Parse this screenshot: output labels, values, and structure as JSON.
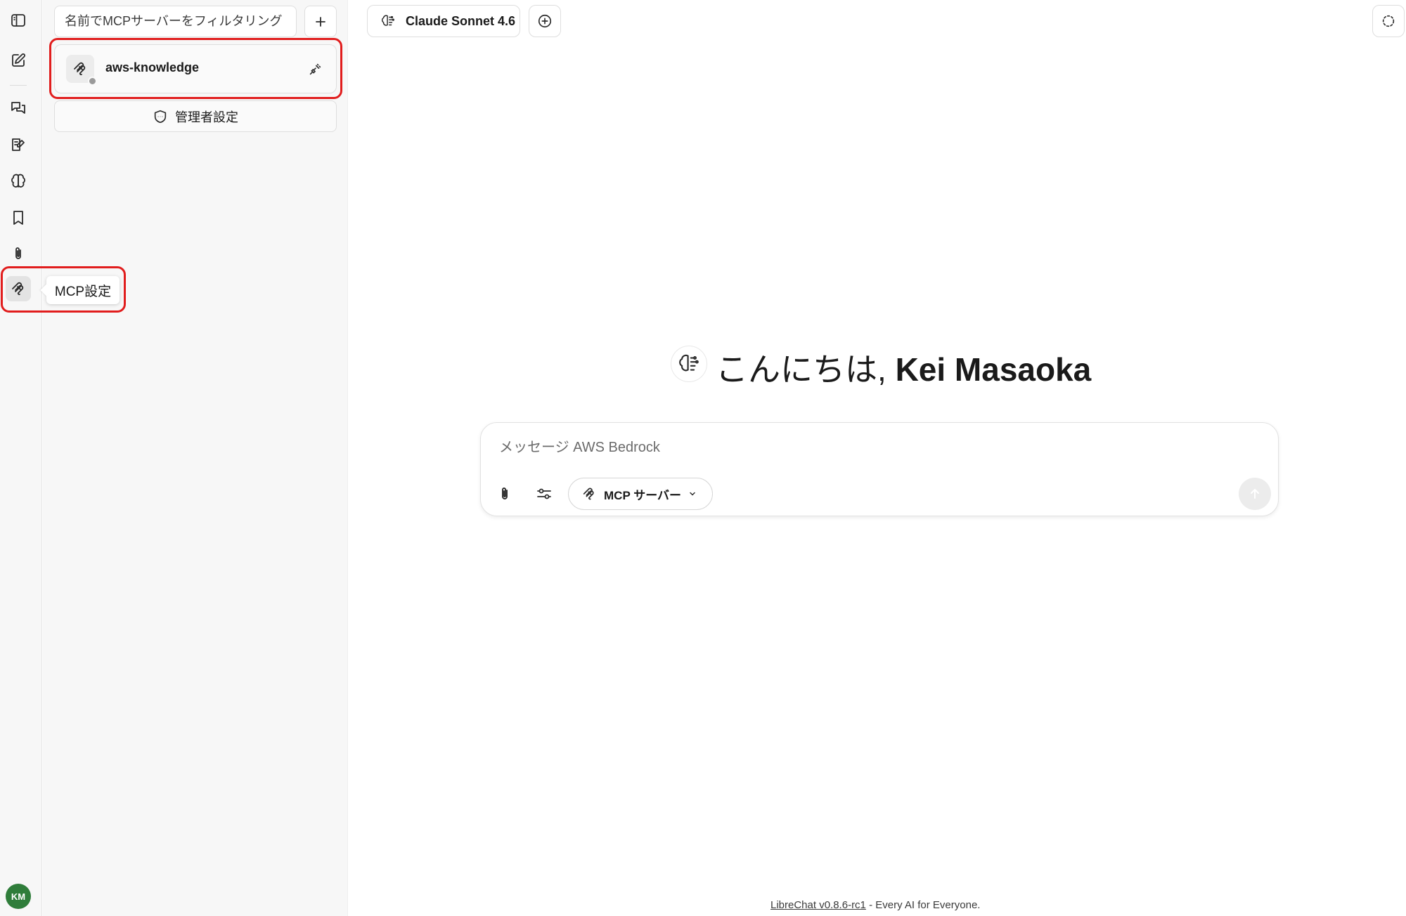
{
  "mcp_panel": {
    "filter_placeholder": "名前でMCPサーバーをフィルタリング",
    "servers": [
      {
        "name": "aws-knowledge",
        "status": "disconnected"
      }
    ],
    "admin_settings_label": "管理者設定"
  },
  "rail": {
    "tooltip": "MCP設定",
    "avatar_initials": "KM"
  },
  "header": {
    "model_name": "Claude Sonnet 4.6"
  },
  "greeting": {
    "prefix": "こんにちは, ",
    "name": "Kei Masaoka"
  },
  "composer": {
    "placeholder": "メッセージ AWS Bedrock",
    "mcp_button_label": "MCP サーバー"
  },
  "footer": {
    "link_text": "LibreChat v0.8.6-rc1",
    "tagline": " - Every AI for Everyone."
  },
  "colors": {
    "highlight": "#e11d1d",
    "avatar": "#2f7d3a"
  }
}
